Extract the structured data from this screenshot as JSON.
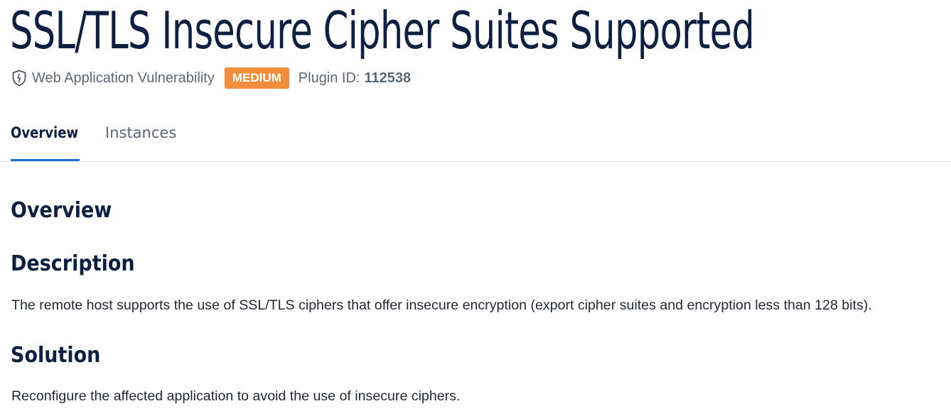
{
  "page": {
    "title": "SSL/TLS Insecure Cipher Suites Supported"
  },
  "meta": {
    "category_icon": "shield-icon",
    "category": "Web Application Vulnerability",
    "severity": "MEDIUM",
    "severity_color": "#f18d3b",
    "plugin_label": "Plugin ID:",
    "plugin_id": "112538"
  },
  "tabs": [
    {
      "label": "Overview",
      "active": true
    },
    {
      "label": "Instances",
      "active": false
    }
  ],
  "accent_color": "#1d6dd3",
  "content": {
    "overview_heading": "Overview",
    "description_heading": "Description",
    "description_text": "The remote host supports the use of SSL/TLS ciphers that offer insecure encryption (export cipher suites and encryption less than 128 bits).",
    "solution_heading": "Solution",
    "solution_text": "Reconfigure the affected application to avoid the use of insecure ciphers."
  }
}
